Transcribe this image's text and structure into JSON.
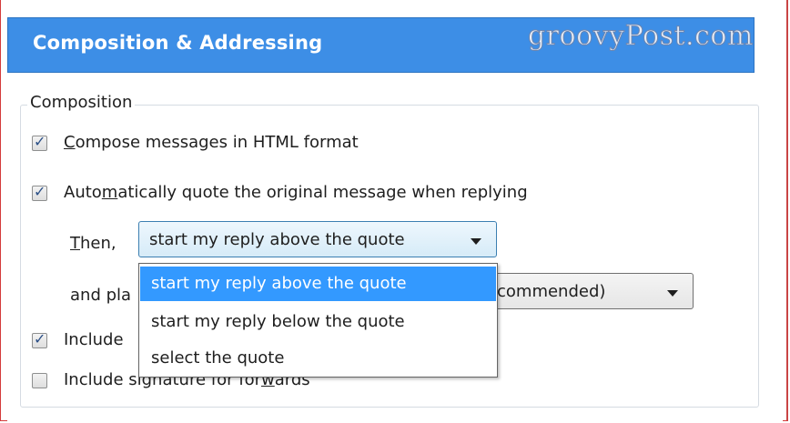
{
  "header": {
    "title": "Composition & Addressing",
    "watermark": "groovyPost.com"
  },
  "composition": {
    "legend": "Composition",
    "compose_html": {
      "label_mnemonic": "C",
      "label_rest": "ompose messages in HTML format",
      "checked": true
    },
    "auto_quote": {
      "label_pre": "Auto",
      "label_mnemonic": "m",
      "label_post": "atically quote the original message when replying",
      "checked": true
    },
    "then_label_mnemonic": "T",
    "then_label_rest": "hen,",
    "reply_position": {
      "selected": "start my reply above the quote",
      "options": [
        "start my reply above the quote",
        "start my reply below the quote",
        "select the quote"
      ],
      "highlighted_index": 0
    },
    "and_place_label": "and pla",
    "signature_placement": {
      "visible_text": "commended)"
    },
    "include_signature_replies": {
      "label": "Include",
      "checked": true
    },
    "include_signature_forwards": {
      "label_pre": "Include signature for for",
      "label_mnemonic": "w",
      "label_post": "ards",
      "checked": false
    }
  },
  "colors": {
    "header_bg": "#3d8ee6",
    "selection_bg": "#3399ff",
    "frame_border": "#d43b3b"
  }
}
